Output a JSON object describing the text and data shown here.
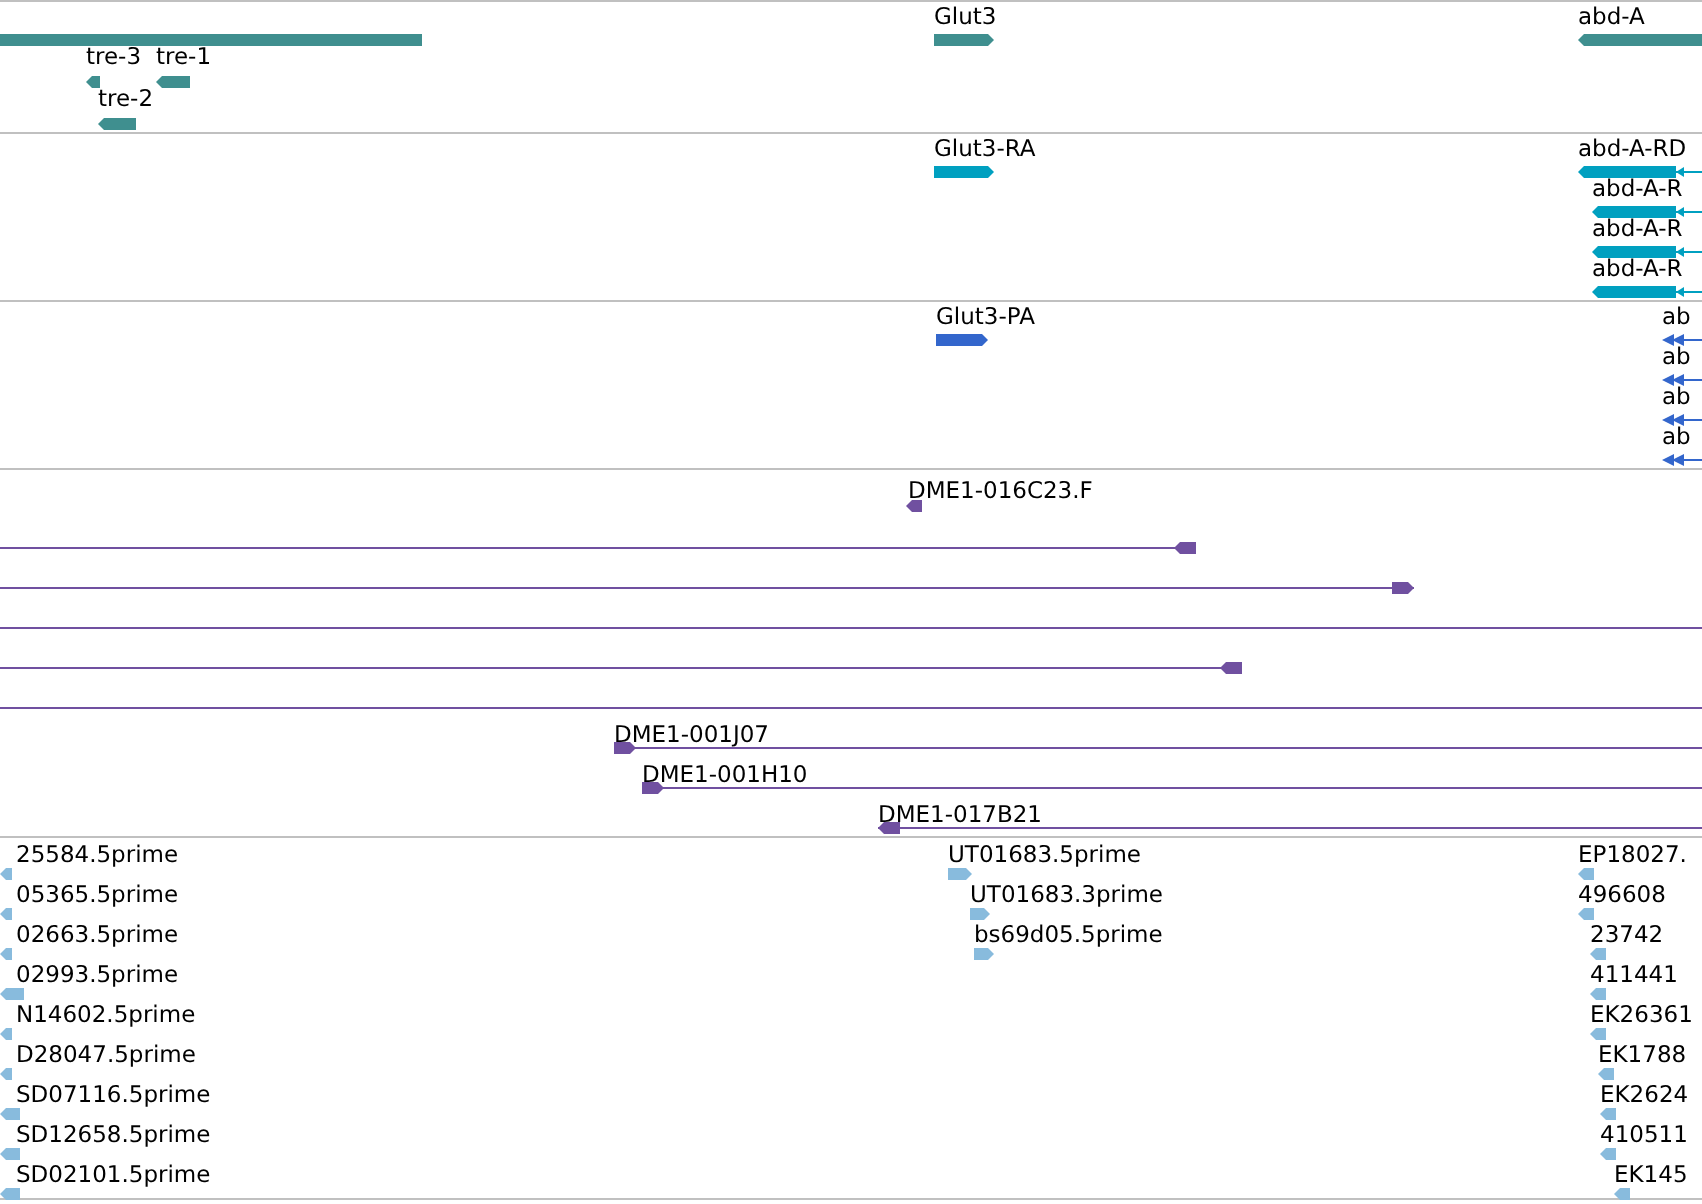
{
  "tracks": [
    {
      "kind": "gene",
      "color": "#3f8f8f",
      "features": [
        {
          "kind": "block"
        },
        {
          "label": "tre-3",
          "kind": "reverse"
        },
        {
          "label": "tre-1",
          "kind": "reverse"
        },
        {
          "label": "tre-2",
          "kind": "reverse"
        },
        {
          "label": "Glut3",
          "kind": "forward"
        },
        {
          "label": "abd-A",
          "kind": "reverse"
        }
      ]
    },
    {
      "kind": "transcript",
      "color": "#00a0c0",
      "features": [
        {
          "label": "Glut3-RA",
          "kind": "forward"
        },
        {
          "label": "abd-A-RD",
          "kind": "reverse"
        },
        {
          "label": "abd-A-R",
          "kind": "reverse"
        },
        {
          "label": "abd-A-R",
          "kind": "reverse"
        },
        {
          "label": "abd-A-R",
          "kind": "reverse"
        }
      ]
    },
    {
      "kind": "translation",
      "color": "#3366cc",
      "features": [
        {
          "label": "Glut3-PA",
          "kind": "forward"
        },
        {
          "label": "ab",
          "kind": "reverse"
        },
        {
          "label": "ab",
          "kind": "reverse"
        },
        {
          "label": "ab",
          "kind": "reverse"
        },
        {
          "label": "ab",
          "kind": "reverse"
        }
      ]
    },
    {
      "kind": "clone",
      "color": "#7050a0",
      "features": [
        {
          "label": "DME1-016C23.F",
          "kind": "reverse"
        },
        {
          "kind": "reverse"
        },
        {
          "kind": "forward"
        },
        {
          "kind": "block"
        },
        {
          "kind": "reverse"
        },
        {
          "kind": "block"
        },
        {
          "label": "DME1-001J07",
          "kind": "forward"
        },
        {
          "label": "DME1-001H10",
          "kind": "forward"
        },
        {
          "label": "DME1-017B21",
          "kind": "reverse"
        }
      ]
    },
    {
      "kind": "est",
      "color": "#88bbdd",
      "features": [
        {
          "label": "25584.5prime",
          "kind": "reverse"
        },
        {
          "label": "05365.5prime",
          "kind": "reverse"
        },
        {
          "label": "02663.5prime",
          "kind": "reverse"
        },
        {
          "label": "02993.5prime",
          "kind": "reverse"
        },
        {
          "label": "N14602.5prime",
          "kind": "reverse"
        },
        {
          "label": "D28047.5prime",
          "kind": "reverse"
        },
        {
          "label": "SD07116.5prime",
          "kind": "reverse"
        },
        {
          "label": "SD12658.5prime",
          "kind": "reverse"
        },
        {
          "label": "SD02101.5prime",
          "kind": "reverse"
        },
        {
          "label": "UT01683.5prime",
          "kind": "forward"
        },
        {
          "label": "UT01683.3prime",
          "kind": "forward"
        },
        {
          "label": "bs69d05.5prime",
          "kind": "forward"
        },
        {
          "label": "EP18027.",
          "kind": "reverse"
        },
        {
          "label": "496608",
          "kind": "reverse"
        },
        {
          "label": "23742",
          "kind": "reverse"
        },
        {
          "label": "411441",
          "kind": "reverse"
        },
        {
          "label": "EK26361",
          "kind": "reverse"
        },
        {
          "label": "EK1788",
          "kind": "reverse"
        },
        {
          "label": "EK2624",
          "kind": "reverse"
        },
        {
          "label": "410511",
          "kind": "reverse"
        },
        {
          "label": "EK145",
          "kind": "reverse"
        }
      ]
    }
  ]
}
